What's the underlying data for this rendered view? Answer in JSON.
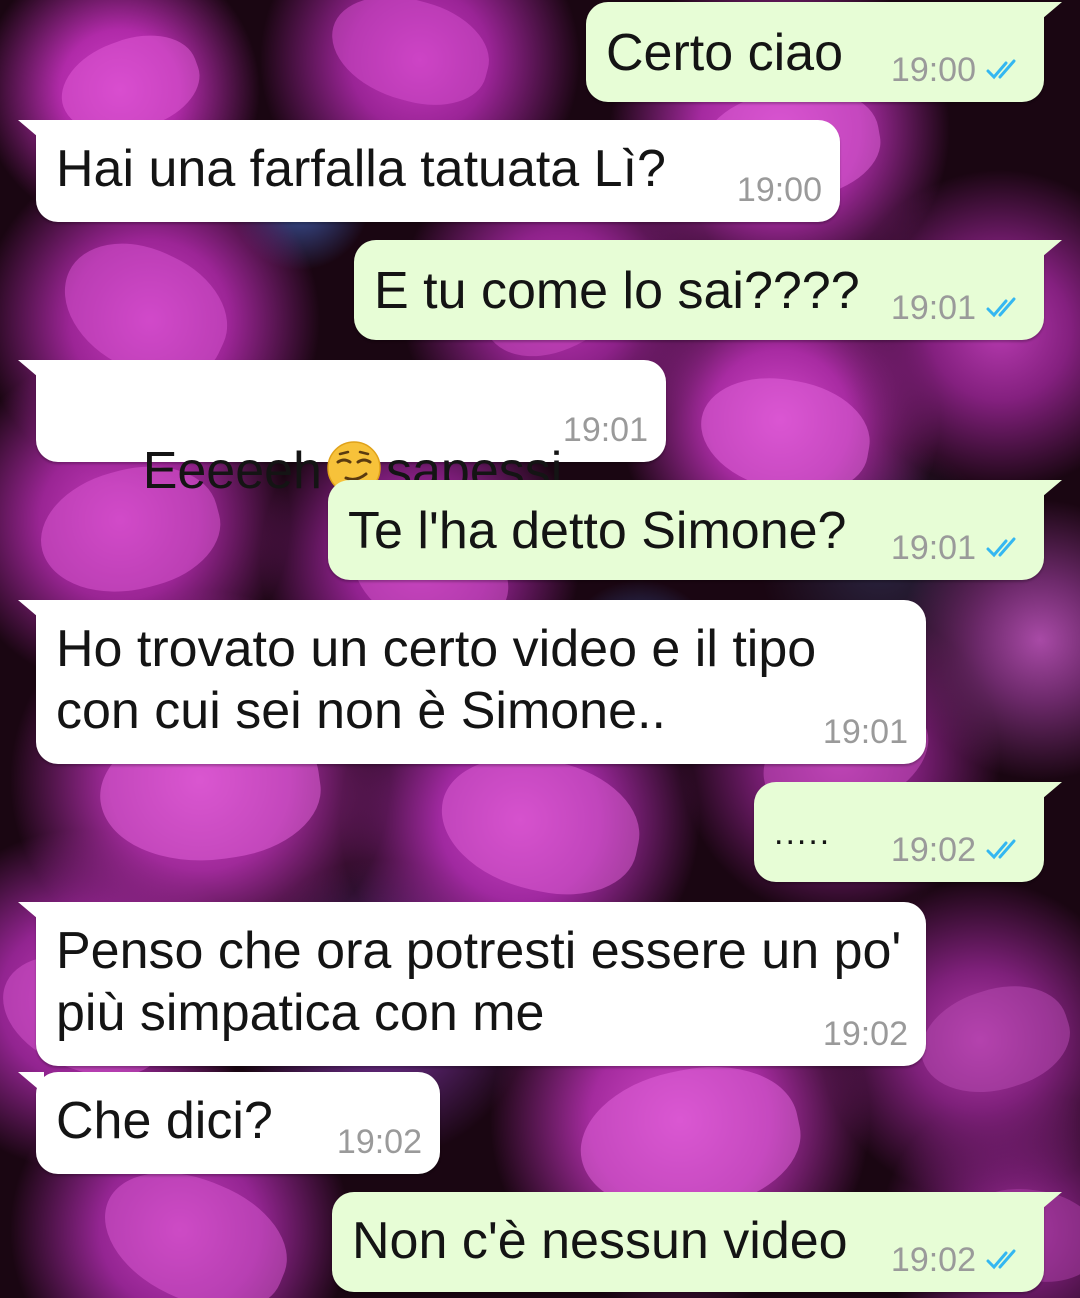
{
  "theme": {
    "incoming_bubble_color": "#ffffff",
    "outgoing_bubble_color": "#e7fdd6",
    "tick_color": "#34b7f1",
    "timestamp_color": "#9a9a9a"
  },
  "messages": [
    {
      "direction": "out",
      "text": "Certo ciao",
      "time": "19:00",
      "status_icon": "double-check-icon"
    },
    {
      "direction": "in",
      "text": "Hai una farfalla tatuata Lì?",
      "time": "19:00"
    },
    {
      "direction": "out",
      "text": "E tu come lo sai????",
      "time": "19:01",
      "status_icon": "double-check-icon"
    },
    {
      "direction": "in",
      "text_before_emoji": "Eeeeeh",
      "emoji": "smirking-face-emoji-icon",
      "text_after_emoji": "sapessi",
      "time": "19:01"
    },
    {
      "direction": "out",
      "text": "Te l'ha detto Simone?",
      "time": "19:01",
      "status_icon": "double-check-icon"
    },
    {
      "direction": "in",
      "text": "Ho trovato un certo video e il tipo\ncon cui sei non è Simone..",
      "time": "19:01"
    },
    {
      "direction": "out",
      "text": ".....",
      "time": "19:02",
      "status_icon": "double-check-icon"
    },
    {
      "direction": "in",
      "text": "Penso che ora potresti essere un po'\npiù simpatica con me",
      "time": "19:02"
    },
    {
      "direction": "in",
      "text": "Che dici?",
      "time": "19:02"
    },
    {
      "direction": "out",
      "text": "Non c'è nessun video",
      "time": "19:02",
      "status_icon": "double-check-icon"
    }
  ]
}
